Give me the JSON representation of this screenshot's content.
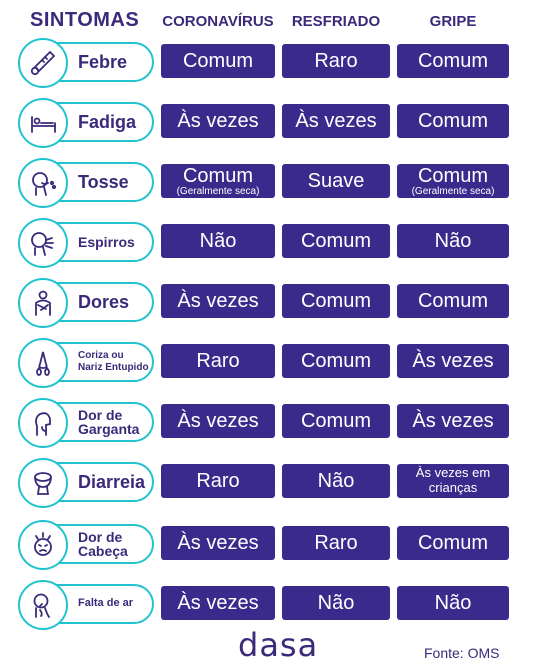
{
  "headers": {
    "symptoms": "SINTOMAS",
    "coronavirus": "CORONAVÍRUS",
    "cold": "RESFRIADO",
    "flu": "GRIPE"
  },
  "rows": [
    {
      "symptom": "Febre",
      "icon": "thermometer-icon",
      "coronavirus": {
        "main": "Comum"
      },
      "cold": {
        "main": "Raro"
      },
      "flu": {
        "main": "Comum"
      }
    },
    {
      "symptom": "Fadiga",
      "icon": "bed-icon",
      "coronavirus": {
        "main": "Às vezes"
      },
      "cold": {
        "main": "Às vezes"
      },
      "flu": {
        "main": "Comum"
      }
    },
    {
      "symptom": "Tosse",
      "icon": "cough-icon",
      "coronavirus": {
        "main": "Comum",
        "note": "(Geralmente seca)"
      },
      "cold": {
        "main": "Suave"
      },
      "flu": {
        "main": "Comum",
        "note": "(Geralmente seca)"
      }
    },
    {
      "symptom": "Espirros",
      "icon": "sneeze-icon",
      "coronavirus": {
        "main": "Não"
      },
      "cold": {
        "main": "Comum"
      },
      "flu": {
        "main": "Não"
      }
    },
    {
      "symptom": "Dores",
      "icon": "body-ache-icon",
      "coronavirus": {
        "main": "Às vezes"
      },
      "cold": {
        "main": "Comum"
      },
      "flu": {
        "main": "Comum"
      }
    },
    {
      "symptom": "Coriza ou Nariz Entupido",
      "icon": "runny-nose-icon",
      "coronavirus": {
        "main": "Raro"
      },
      "cold": {
        "main": "Comum"
      },
      "flu": {
        "main": "Às vezes"
      }
    },
    {
      "symptom": "Dor de Garganta",
      "icon": "sore-throat-icon",
      "coronavirus": {
        "main": "Às vezes"
      },
      "cold": {
        "main": "Comum"
      },
      "flu": {
        "main": "Às vezes"
      }
    },
    {
      "symptom": "Diarreia",
      "icon": "toilet-icon",
      "coronavirus": {
        "main": "Raro"
      },
      "cold": {
        "main": "Não"
      },
      "flu": {
        "main": "Às vezes em crianças"
      }
    },
    {
      "symptom": "Dor de Cabeça",
      "icon": "headache-icon",
      "coronavirus": {
        "main": "Às vezes"
      },
      "cold": {
        "main": "Raro"
      },
      "flu": {
        "main": "Comum"
      }
    },
    {
      "symptom": "Falta de ar",
      "icon": "shortness-of-breath-icon",
      "coronavirus": {
        "main": "Às vezes"
      },
      "cold": {
        "main": "Não"
      },
      "flu": {
        "main": "Não"
      }
    }
  ],
  "footer": {
    "logo": "dasa",
    "source": "Fonte: OMS"
  },
  "colors": {
    "cell_bg": "#3a2a8c",
    "text": "#3b2a7a",
    "accent": "#21c3cf"
  }
}
